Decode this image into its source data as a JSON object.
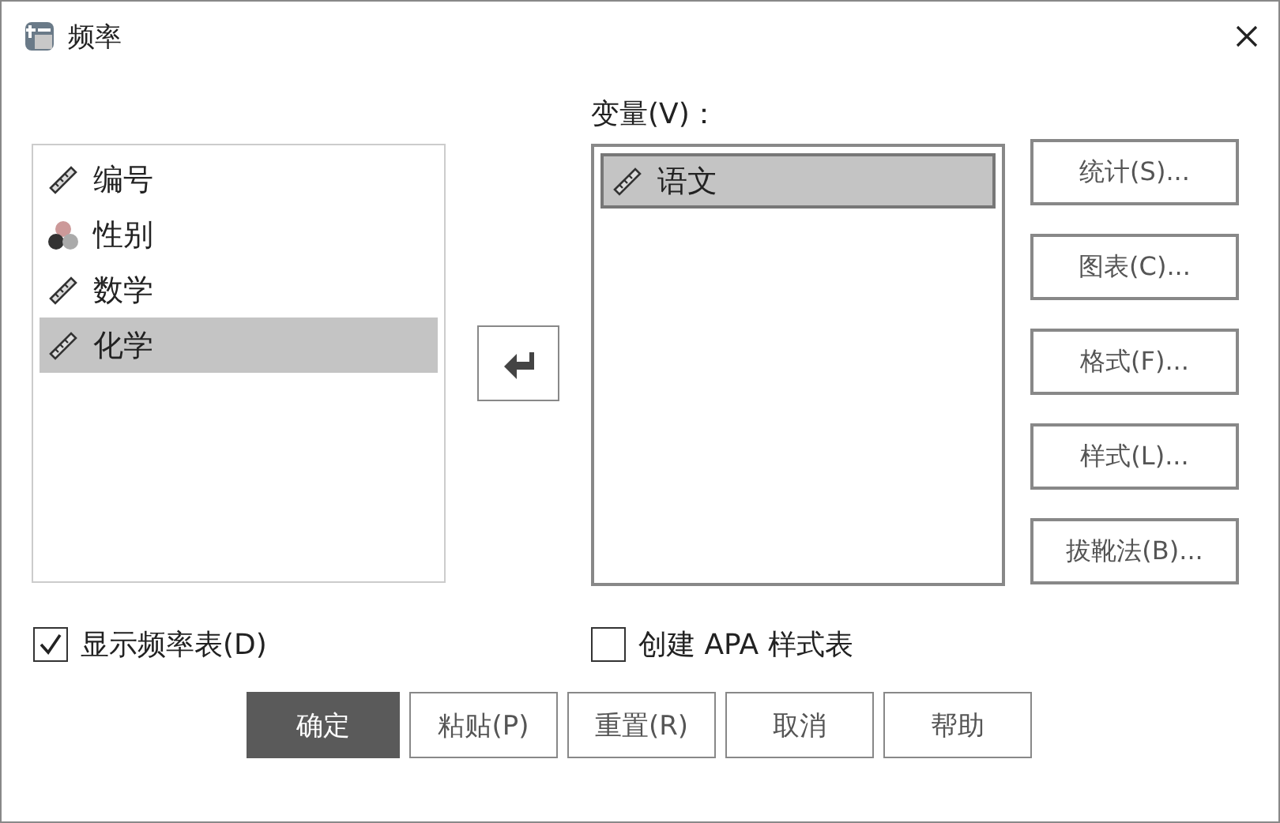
{
  "window": {
    "title": "频率"
  },
  "source_list": {
    "items": [
      {
        "label": "编号",
        "kind": "scale",
        "selected": false
      },
      {
        "label": "性别",
        "kind": "nominal",
        "selected": false
      },
      {
        "label": "数学",
        "kind": "scale",
        "selected": false
      },
      {
        "label": "化学",
        "kind": "scale",
        "selected": true
      }
    ]
  },
  "variables": {
    "label": "变量(V)：",
    "items": [
      {
        "label": "语文",
        "kind": "scale",
        "selected": true
      }
    ]
  },
  "side_buttons": [
    "统计(S)...",
    "图表(C)...",
    "格式(F)...",
    "样式(L)...",
    "拔靴法(B)..."
  ],
  "options": [
    {
      "label": "显示频率表(D)",
      "checked": true
    },
    {
      "label": "创建 APA 样式表",
      "checked": false
    }
  ],
  "buttons": [
    {
      "label": "确定",
      "default": true
    },
    {
      "label": "粘贴(P)",
      "default": false
    },
    {
      "label": "重置(R)",
      "default": false
    },
    {
      "label": "取消",
      "default": false
    },
    {
      "label": "帮助",
      "default": false
    }
  ]
}
